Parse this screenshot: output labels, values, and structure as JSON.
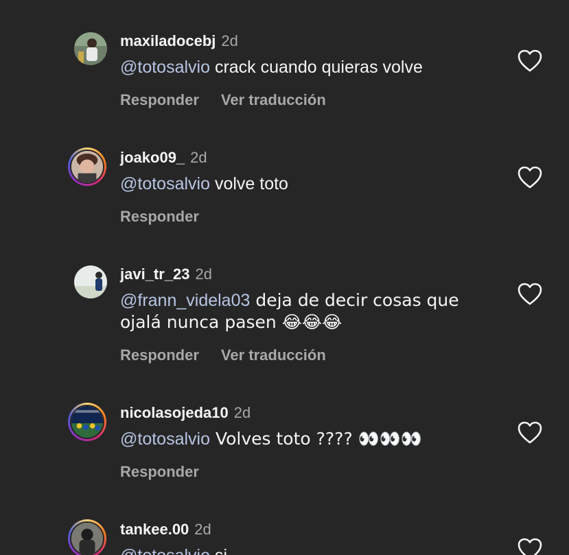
{
  "comments": [
    {
      "username": "maxiladocebj",
      "time": "2d",
      "mention": "@totosalvio",
      "text": " crack cuando quieras volve",
      "reply": "Responder",
      "translate": "Ver traducción",
      "avatar_ring": false
    },
    {
      "username": "joako09_",
      "time": "2d",
      "mention": "@totosalvio",
      "text": " volve toto",
      "reply": "Responder",
      "translate": "",
      "avatar_ring": true
    },
    {
      "username": "javi_tr_23",
      "time": "2d",
      "mention": "@frann_videla03",
      "text": " deja de decir cosas que ojalá nunca pasen 😂😂😂",
      "reply": "Responder",
      "translate": "Ver traducción",
      "avatar_ring": false
    },
    {
      "username": "nicolasojeda10",
      "time": "2d",
      "mention": "@totosalvio",
      "text": " Volves toto ???? 👀👀👀",
      "reply": "Responder",
      "translate": "",
      "avatar_ring": true
    },
    {
      "username": "tankee.00",
      "time": "2d",
      "mention": "@totosalvio",
      "text": " si",
      "reply": "",
      "translate": "",
      "avatar_ring": true
    }
  ],
  "colors": {
    "background": "#262626",
    "primary_text": "#f5f5f5",
    "secondary_text": "#a8a8a8",
    "mention": "#b7c5e4"
  },
  "icons": {
    "like": "heart-outline-icon"
  }
}
